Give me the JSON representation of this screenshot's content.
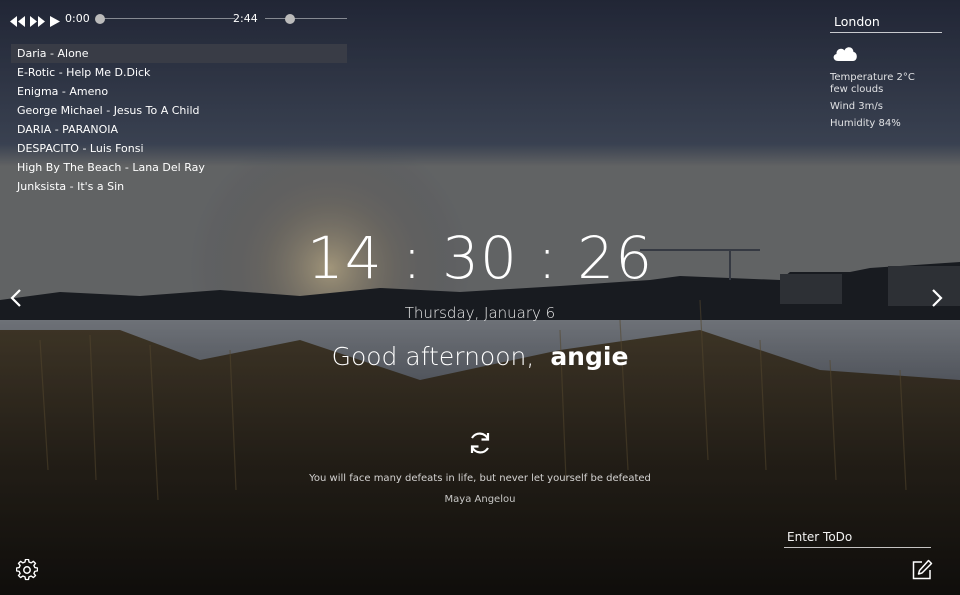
{
  "player": {
    "current_time": "0:00",
    "duration": "2:44",
    "progress": 0,
    "volume": 0.3
  },
  "playlist": {
    "tracks": [
      "Daria - Alone",
      "E-Rotic - Help Me D.Dick",
      "Enigma - Ameno",
      "George Michael - Jesus To A Child",
      "DARIA - PARANOIA",
      "DESPACITO - Luis Fonsi",
      "High By The Beach - Lana Del Ray",
      "Junksista - It's a Sin"
    ],
    "active_index": 0
  },
  "weather": {
    "city": "London",
    "icon": "cloud-icon",
    "temperature": "Temperature 2°C",
    "description": "few clouds",
    "wind": "Wind 3m/s",
    "humidity": "Humidity 84%"
  },
  "clock": {
    "time": "14 : 30 : 26",
    "date": "Thursday, January 6"
  },
  "greeting": {
    "text": "Good afternoon,",
    "name": "angie"
  },
  "quote": {
    "text": "You will face many defeats in life, but never let yourself be defeated",
    "author": "Maya Angelou"
  },
  "todo": {
    "placeholder": "Enter ToDo"
  },
  "icons": {
    "prev": "rewind-icon",
    "next": "fast-forward-icon",
    "play": "play-icon",
    "slide_prev": "chevron-left-icon",
    "slide_next": "chevron-right-icon",
    "refresh": "refresh-icon",
    "settings": "gear-icon",
    "edit": "edit-icon"
  },
  "colors": {
    "sky_top": "#2e3447",
    "water": "#9a9ea6",
    "reeds": "#5a4a30",
    "active_track_bg": "#3c3e48"
  }
}
